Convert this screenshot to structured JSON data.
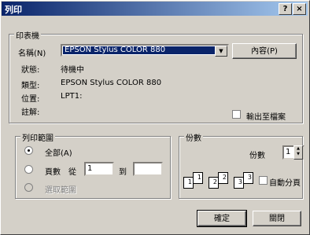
{
  "window": {
    "title": "列印",
    "help_glyph": "?",
    "close_glyph": "×"
  },
  "printer_group": {
    "legend": "印表機",
    "name_label": "名稱(N)",
    "name_value": "EPSON Stylus COLOR 880",
    "properties_button": "內容(P)",
    "status_label": "狀態:",
    "status_value": "待機中",
    "type_label": "類型:",
    "type_value": "EPSON Stylus COLOR 880",
    "where_label": "位置:",
    "where_value": "LPT1:",
    "comment_label": "註解:",
    "print_to_file": "輸出至檔案"
  },
  "range_group": {
    "legend": "列印範圍",
    "all": "全部(A)",
    "pages": "頁數",
    "from_label": "從",
    "from_value": "1",
    "to_label": "到",
    "to_value": "",
    "selection": "選取範圍"
  },
  "copies_group": {
    "legend": "份數",
    "copies_label": "份數",
    "copies_value": "1",
    "collate": "自動分頁",
    "pages": [
      "1",
      "1",
      "2",
      "2",
      "3",
      "3"
    ]
  },
  "buttons": {
    "ok": "確定",
    "cancel": "關閉"
  }
}
